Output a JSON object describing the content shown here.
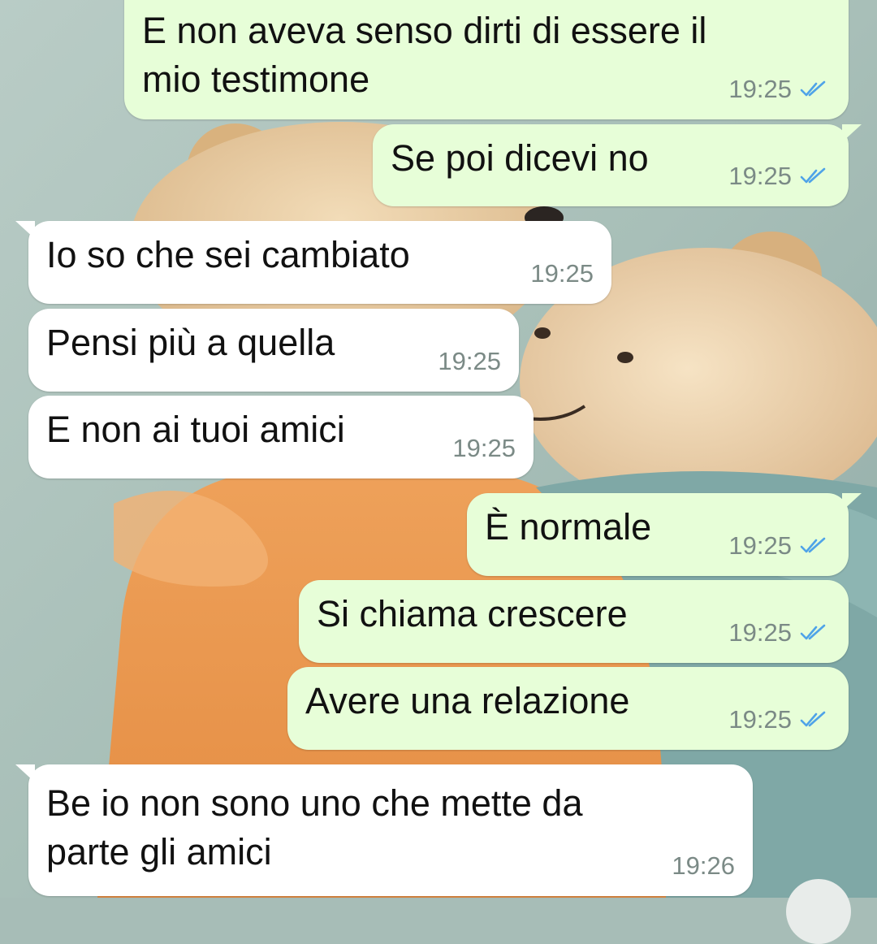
{
  "colors": {
    "outgoing_bubble": "#e7fed8",
    "incoming_bubble": "#ffffff",
    "read_ticks": "#4fa3e8",
    "timestamp": "#7b8a86"
  },
  "messages": [
    {
      "direction": "out",
      "text": "E non aveva senso dirti di essere il\nmio testimone",
      "time": "19:25",
      "status": "read-ticks-icon"
    },
    {
      "direction": "out",
      "text": "Se poi dicevi no",
      "time": "19:25",
      "status": "read-ticks-icon"
    },
    {
      "direction": "in",
      "text": "Io so che sei cambiato",
      "time": "19:25"
    },
    {
      "direction": "in",
      "text": "Pensi più a quella",
      "time": "19:25"
    },
    {
      "direction": "in",
      "text": "E non ai tuoi amici",
      "time": "19:25"
    },
    {
      "direction": "out",
      "text": "È normale",
      "time": "19:25",
      "status": "read-ticks-icon"
    },
    {
      "direction": "out",
      "text": "Si chiama crescere",
      "time": "19:25",
      "status": "read-ticks-icon"
    },
    {
      "direction": "out",
      "text": "Avere una relazione",
      "time": "19:25",
      "status": "read-ticks-icon"
    },
    {
      "direction": "in",
      "text": "Be io non sono uno che mette da\nparte gli amici",
      "time": "19:26"
    }
  ]
}
